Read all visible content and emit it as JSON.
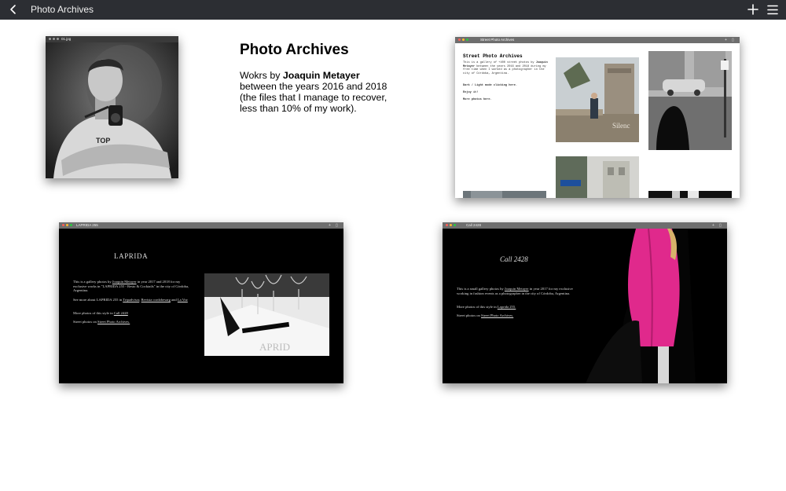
{
  "header": {
    "title": "Photo Archives"
  },
  "intro": {
    "title": "Photo Archives",
    "line_prefix": "Wokrs by ",
    "author": "Joaquin Metayer",
    "line_rest": "between the years 2016 and 2018 (the files that I manage to recover, less than 10% of my work)."
  },
  "photo_window": {
    "title": "01.jpg"
  },
  "street_window": {
    "title": "Street Photo Archives",
    "heading": "Street Photo Archives",
    "p1_prefix": "This is a gallery of +400 street photos by ",
    "p1_author": "Joaquin Metayer",
    "p1_rest": " between the years 2016 and 2018 during my free time when I worked as a photographer in the city of Córdoba, Argentina.",
    "p2": "Dark / Light mode clicking here.",
    "p3": "Enjoy it!",
    "p4": "More photos here."
  },
  "laprida_window": {
    "title": "LAPRIDA 255",
    "logo": "LAPRIDA",
    "p1_prefix": "This is a gallery photos by ",
    "p1_author": "Joaquin Metayer",
    "p1_rest": " in year 2017 and 2018 for my exclusive works in \"LAPRIDA 255 - Resto & Cocktails\" in the city of Córdoba, Argentina.",
    "p2_prefix": "See more about LAPRIDA 255 in ",
    "p2_link1": "Tripadvisor",
    "p2_sep": ", ",
    "p2_link2": "Revista cordobesarg",
    "p2_and": " and ",
    "p2_link3": "La Voz",
    "p3_prefix": "More photos of this style in ",
    "p3_link": "Call 2428",
    "p4_prefix": "Street photos on ",
    "p4_link": "Street Photo Archives."
  },
  "call_window": {
    "title": "Call 2428",
    "logo": "Call 2428",
    "p1_prefix": "This is a small gallery photos by ",
    "p1_author": "Joaquin Metayer",
    "p1_rest": " in year 2017 for my exclusive working in fashion events as a photographer in the city of Córdoba, Argentina.",
    "p2_prefix": "More photos of this style in ",
    "p2_link": "Laprida 255.",
    "p3_prefix": "Street photos on ",
    "p3_link": "Street Photo Archives."
  }
}
